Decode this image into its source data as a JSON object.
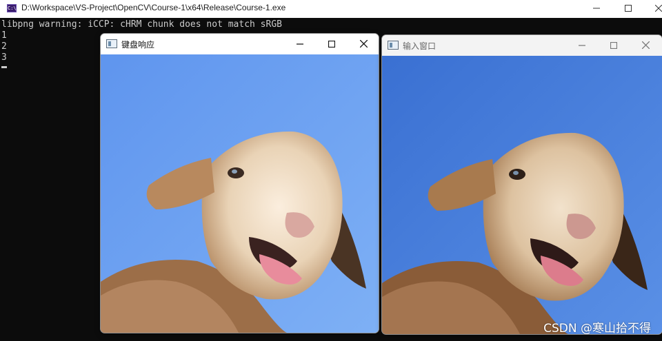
{
  "console": {
    "title": "D:\\Workspace\\VS-Project\\OpenCV\\Course-1\\x64\\Release\\Course-1.exe",
    "icon_text": "C:\\",
    "lines": [
      "libpng warning: iCCP: cHRM chunk does not match sRGB",
      "1",
      "2",
      "3"
    ]
  },
  "windows": {
    "keyboard": {
      "title": "键盘响应"
    },
    "input": {
      "title": "输入窗口"
    }
  },
  "icons": [
    "minimize-icon",
    "maximize-icon",
    "close-icon",
    "window-app-icon",
    "console-app-icon"
  ],
  "colors": {
    "sky_left": "#6a9ef0",
    "sky_right": "#3f78d8",
    "console_bg": "#0c0c0c"
  },
  "watermark": "CSDN @寒山拾不得"
}
